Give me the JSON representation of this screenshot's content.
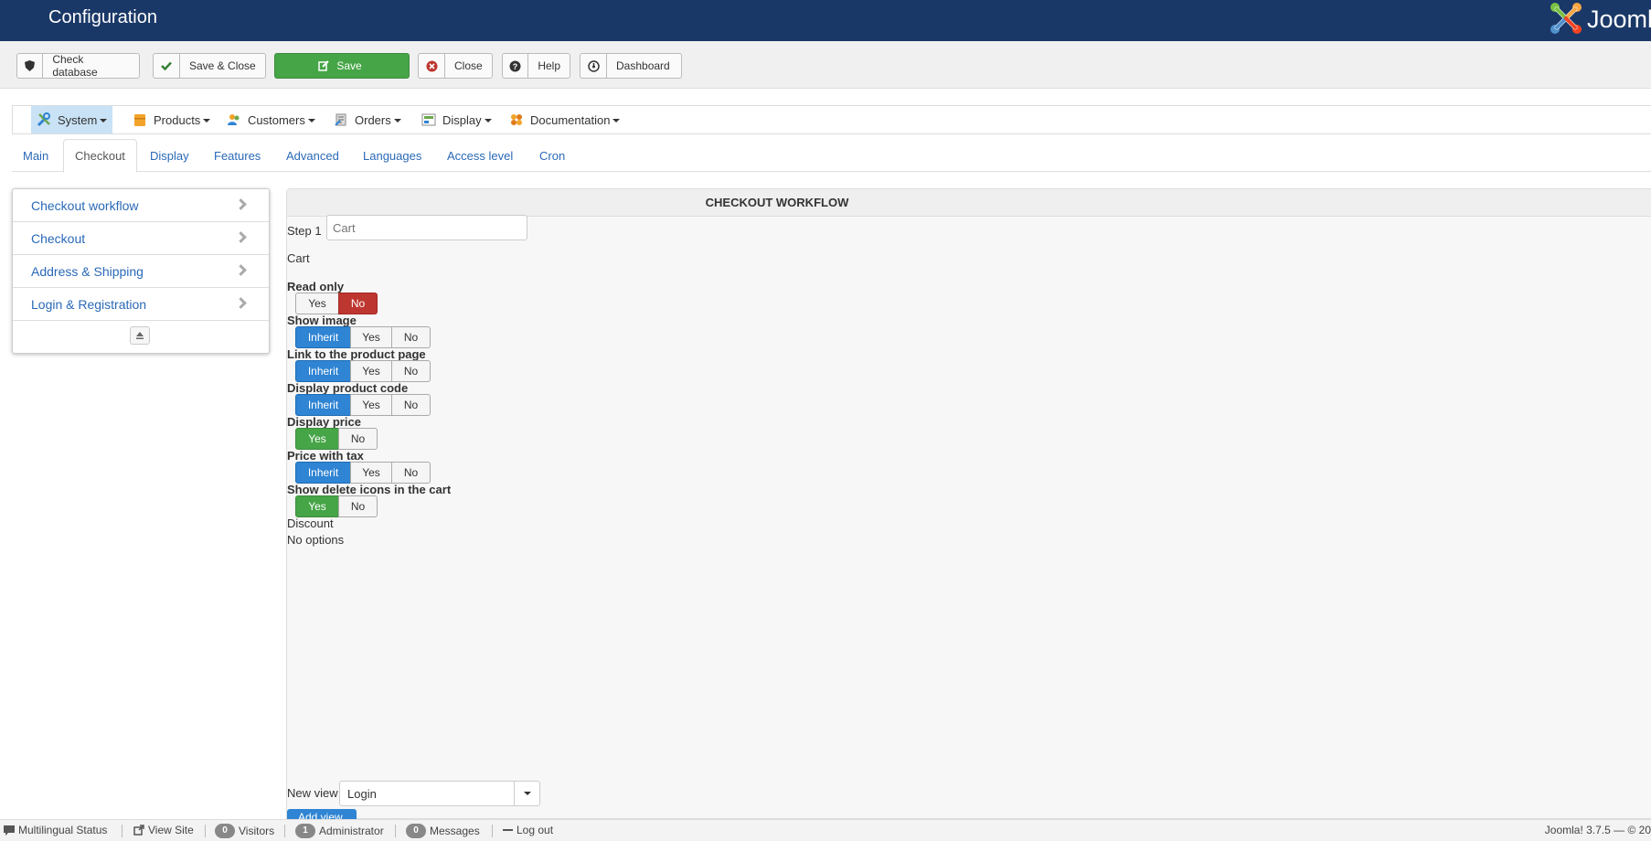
{
  "header": {
    "title": "Configuration",
    "logo_text": "Joomla!"
  },
  "toolbar": {
    "check_database": "Check database",
    "save_close": "Save & Close",
    "save": "Save",
    "close": "Close",
    "help": "Help",
    "dashboard": "Dashboard"
  },
  "menu": [
    {
      "label": "System",
      "icon": "tools-icon"
    },
    {
      "label": "Products",
      "icon": "products-icon"
    },
    {
      "label": "Customers",
      "icon": "customers-icon"
    },
    {
      "label": "Orders",
      "icon": "orders-icon"
    },
    {
      "label": "Display",
      "icon": "display-icon"
    },
    {
      "label": "Documentation",
      "icon": "documentation-icon"
    }
  ],
  "tabs": [
    "Main",
    "Checkout",
    "Display",
    "Features",
    "Advanced",
    "Languages",
    "Access level",
    "Cron"
  ],
  "active_tab": "Checkout",
  "sidebar": [
    "Checkout workflow",
    "Checkout",
    "Address & Shipping",
    "Login & Registration"
  ],
  "panel": {
    "title": "CHECKOUT WORKFLOW",
    "step_label": "Step 1",
    "step_placeholder": "Cart",
    "cart_label": "Cart",
    "fields": [
      {
        "label": "Read only",
        "options": [
          "Yes",
          "No"
        ],
        "selected": "No"
      },
      {
        "label": "Show image",
        "options": [
          "Inherit",
          "Yes",
          "No"
        ],
        "selected": "Inherit"
      },
      {
        "label": "Link to the product page",
        "options": [
          "Inherit",
          "Yes",
          "No"
        ],
        "selected": "Inherit"
      },
      {
        "label": "Display product code",
        "options": [
          "Inherit",
          "Yes",
          "No"
        ],
        "selected": "Inherit"
      },
      {
        "label": "Display price",
        "options": [
          "Yes",
          "No"
        ],
        "selected": "Yes"
      },
      {
        "label": "Price with tax",
        "options": [
          "Inherit",
          "Yes",
          "No"
        ],
        "selected": "Inherit"
      },
      {
        "label": "Show delete icons in the cart",
        "options": [
          "Yes",
          "No"
        ],
        "selected": "Yes"
      }
    ],
    "discount_label": "Discount",
    "no_options": "No options",
    "new_view_label": "New view",
    "new_view_value": "Login",
    "add_button": "Add view"
  },
  "statusbar": {
    "multilingual": "Multilingual Status",
    "view_site": "View Site",
    "visitors_count": "0",
    "visitors": "Visitors",
    "admin_count": "1",
    "administrator": "Administrator",
    "messages_count": "0",
    "messages": "Messages",
    "logout": "Log out",
    "version": "Joomla! 3.7.5 — © 20"
  },
  "colors": {
    "header_bg": "#1a3867",
    "save_green": "#46a546",
    "inherit_blue": "#2f84d3",
    "no_red": "#bd362f",
    "link_blue": "#2a69b8"
  }
}
